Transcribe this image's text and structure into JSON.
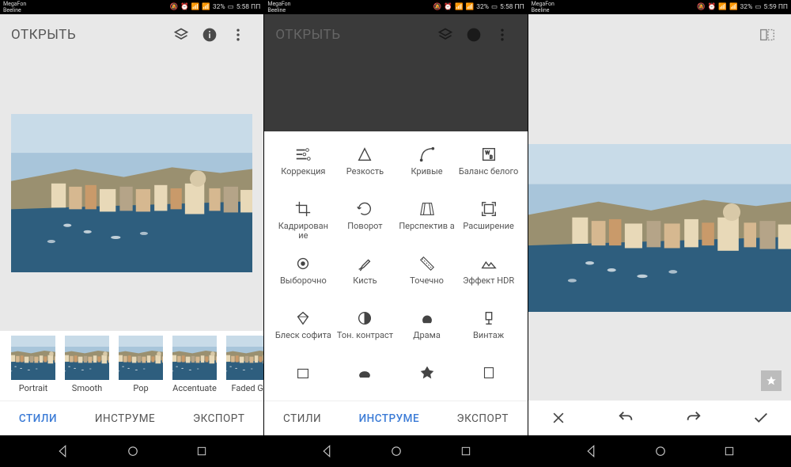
{
  "status": {
    "carrier1": "MegaFon",
    "carrier2": "Beeline",
    "battery": "32%",
    "time_a": "5:58 ПП",
    "time_b": "5:59 ПП"
  },
  "app": {
    "open_label": "ОТКРЫТЬ"
  },
  "styles": [
    {
      "label": "Portrait"
    },
    {
      "label": "Smooth"
    },
    {
      "label": "Pop"
    },
    {
      "label": "Accentuate"
    },
    {
      "label": "Faded Gl"
    }
  ],
  "tabs": {
    "styles": "СТИЛИ",
    "tools": "ИНСТРУМЕ",
    "export": "ЭКСПОРТ"
  },
  "tools": [
    {
      "icon": "tune",
      "label": "Коррекция"
    },
    {
      "icon": "details",
      "label": "Резкость"
    },
    {
      "icon": "curves",
      "label": "Кривые"
    },
    {
      "icon": "wb",
      "label": "Баланс белого"
    },
    {
      "icon": "crop",
      "label": "Кадрирован ие"
    },
    {
      "icon": "rotate",
      "label": "Поворот"
    },
    {
      "icon": "perspective",
      "label": "Перспектив а"
    },
    {
      "icon": "expand",
      "label": "Расширение"
    },
    {
      "icon": "selective",
      "label": "Выборочно"
    },
    {
      "icon": "brush",
      "label": "Кисть"
    },
    {
      "icon": "healing",
      "label": "Точечно"
    },
    {
      "icon": "hdr",
      "label": "Эффект HDR"
    },
    {
      "icon": "glamour",
      "label": "Блеск софита"
    },
    {
      "icon": "tonal",
      "label": "Тон. контраст"
    },
    {
      "icon": "drama",
      "label": "Драма"
    },
    {
      "icon": "vintage",
      "label": "Винтаж"
    },
    {
      "icon": "more1",
      "label": ""
    },
    {
      "icon": "more2",
      "label": ""
    },
    {
      "icon": "more3",
      "label": ""
    },
    {
      "icon": "more4",
      "label": ""
    }
  ]
}
